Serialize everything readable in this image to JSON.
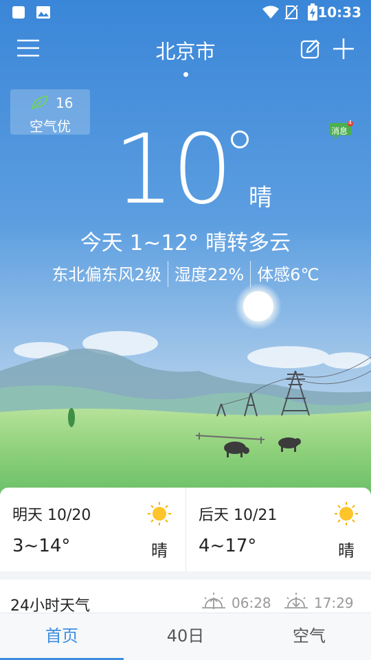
{
  "status_bar": {
    "time": "10:33"
  },
  "header": {
    "city": "北京市"
  },
  "aqi": {
    "value": "16",
    "label": "空气优"
  },
  "message_badge": {
    "label": "消息",
    "count": "4"
  },
  "current": {
    "temperature": "10",
    "condition": "晴",
    "today_summary": "今天 1~12° 晴转多云",
    "wind": "东北偏东风2级",
    "humidity": "湿度22%",
    "feels_like": "体感6℃"
  },
  "forecast": [
    {
      "day": "明天 10/20",
      "range": "3~14°",
      "condition": "晴",
      "icon": "sun-icon"
    },
    {
      "day": "后天 10/21",
      "range": "4~17°",
      "condition": "晴",
      "icon": "sun-icon"
    }
  ],
  "hourly": {
    "title": "24小时天气",
    "sunrise": "06:28",
    "sunset": "17:29"
  },
  "nav": {
    "tabs": [
      "首页",
      "40日",
      "空气"
    ],
    "active": 0
  },
  "colors": {
    "accent": "#3d8ddf",
    "sky_top": "#3a86d8",
    "sky_bottom": "#a6c9ea",
    "grass": "#8dd07a"
  }
}
